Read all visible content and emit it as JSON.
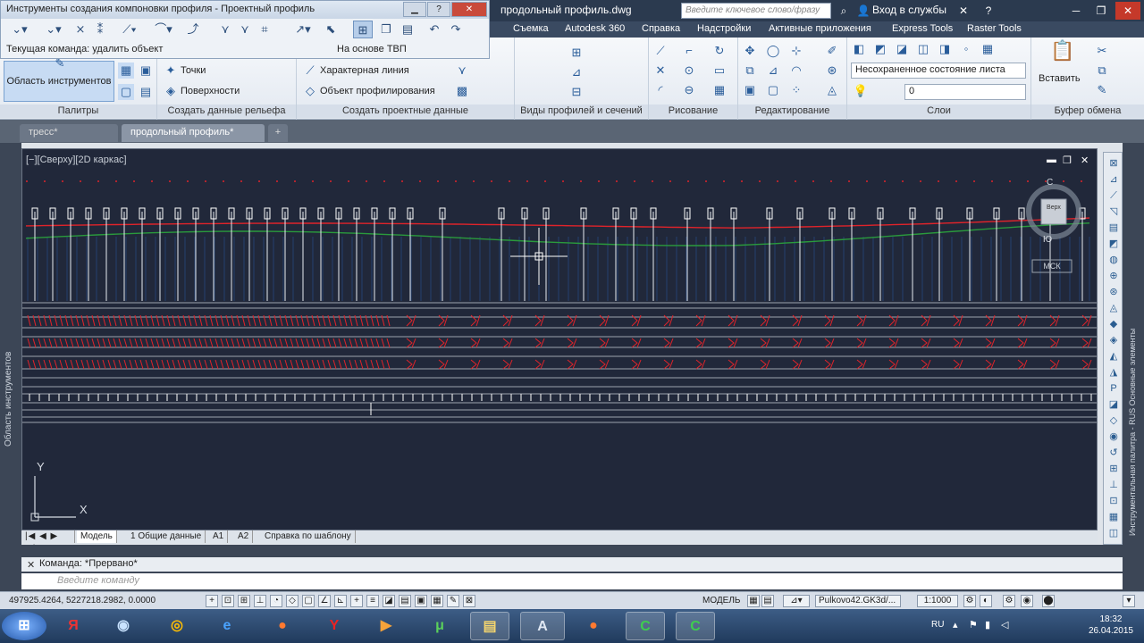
{
  "app": {
    "doc_title": "продольный профиль.dwg",
    "search_placeholder": "Введите ключевое слово/фразу",
    "login_label": "Вход в службы"
  },
  "toolbox": {
    "title": "Инструменты создания компоновки профиля - Проектный профиль",
    "current_command": "Текущая команда: удалить объект",
    "based_on": "На основе ТВП"
  },
  "menu_tabs": [
    "Съемка",
    "Autodesk 360",
    "Справка",
    "Надстройки",
    "Активные приложения",
    "Express Tools",
    "Raster Tools"
  ],
  "ribbon": {
    "palettes": {
      "tool_button": "Область инструментов",
      "label": "Палитры"
    },
    "terrain": {
      "points": "Точки",
      "surfaces": "Поверхности",
      "label": "Создать данные рельефа"
    },
    "design": {
      "feature_line": "Характерная линия",
      "grading": "Объект профилирования",
      "label": "Создать проектные данные"
    },
    "views": {
      "label": "Виды профилей и сечений"
    },
    "draw": {
      "label": "Рисование"
    },
    "modify": {
      "label": "Редактирование"
    },
    "layers": {
      "state": "Несохраненное состояние листа",
      "current_layer": "0",
      "label": "Слои"
    },
    "clipboard": {
      "paste": "Вставить",
      "label": "Буфер обмена"
    }
  },
  "doc_tabs": [
    "тресс*",
    "продольный профиль*"
  ],
  "viewport": {
    "label": "[−][Сверху][2D каркас]",
    "ucs_y": "Y",
    "ucs_x": "X",
    "compass_n": "С",
    "compass_s": "Ю",
    "compass_center": "Верх",
    "mcs_label": "МСК"
  },
  "left_palette_title": "Область инструментов",
  "right_palette_title": "Инструментальная палитра - RUS Основные элементы",
  "layout_tabs": [
    "Модель",
    "1 Общие данные",
    "A1",
    "A2",
    "Справка по шаблону"
  ],
  "command": {
    "history": "Команда:  *Прервано*",
    "placeholder": "Введите команду"
  },
  "status": {
    "coords": "497925.4264, 5227218.2982, 0.0000",
    "model": "МОДЕЛЬ",
    "coord_system": "Pulkovo42.GK3d/...",
    "scale": "1:1000"
  },
  "taskbar": {
    "lang": "RU",
    "time": "18:32",
    "date": "26.04.2015"
  },
  "colors": {
    "canvas": "#21283a",
    "profile_red": "#e0232a",
    "ground_green": "#2a9a3c",
    "grid_blue": "#2d6fd0"
  }
}
